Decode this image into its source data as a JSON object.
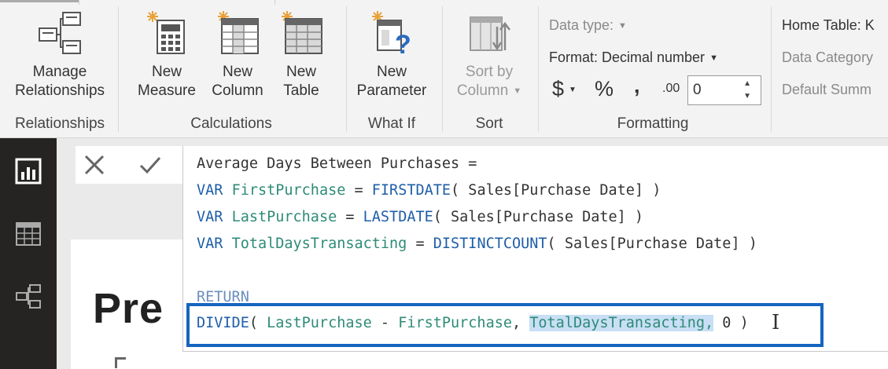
{
  "ribbon": {
    "groups": {
      "relationships": "Relationships",
      "calculations": "Calculations",
      "whatif": "What If",
      "sort": "Sort",
      "formatting": "Formatting"
    },
    "buttons": {
      "manage_line1": "Manage",
      "manage_line2": "Relationships",
      "new_measure_line1": "New",
      "new_measure_line2": "Measure",
      "new_column_line1": "New",
      "new_column_line2": "Column",
      "new_table_line1": "New",
      "new_table_line2": "Table",
      "new_param_line1": "New",
      "new_param_line2": "Parameter",
      "sort_line1": "Sort by",
      "sort_line2": "Column"
    },
    "formatting": {
      "data_type": "Data type:",
      "format": "Format: Decimal number",
      "currency": "$",
      "percent": "%",
      "comma": ",",
      "decimals_label": ".00",
      "decimals_value": "0"
    },
    "properties": {
      "home_table": "Home Table: K",
      "data_category": "Data Category",
      "default_summ": "Default Summ"
    }
  },
  "canvas": {
    "page_title": "Pre"
  },
  "formula": {
    "line1": "Average Days Between Purchases =",
    "line2_kw": "VAR",
    "line2_var": "FirstPurchase",
    "line2_eq": " = ",
    "line2_fn": "FIRSTDATE",
    "line2_rest": "( Sales[Purchase Date] )",
    "line3_kw": "VAR",
    "line3_var": "LastPurchase",
    "line3_eq": " = ",
    "line3_fn": "LASTDATE",
    "line3_rest": "( Sales[Purchase Date] )",
    "line4_kw": "VAR",
    "line4_var": "TotalDaysTransacting",
    "line4_eq": " = ",
    "line4_fn": "DISTINCTCOUNT",
    "line4_rest": "( Sales[Purchase Date] )",
    "line5": "RETURN",
    "line6_fn": "DIVIDE",
    "line6_open": "( ",
    "line6_a": "LastPurchase",
    "line6_minus": " - ",
    "line6_b": "FirstPurchase",
    "line6_comma": ", ",
    "line6_sel": "TotalDaysTransacting,",
    "line6_end": " 0 )"
  },
  "colors": {
    "keyword": "#1e5ea8",
    "variable": "#2e8b76",
    "selection": "#c8dff5",
    "focus_box": "#1565c0",
    "nav_bg": "#252423"
  }
}
